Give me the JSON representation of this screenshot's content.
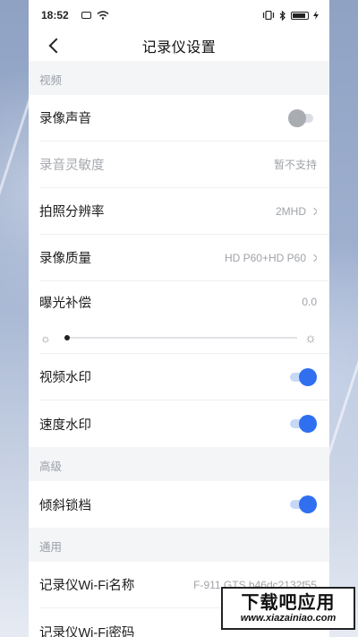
{
  "status_bar": {
    "time": "18:52"
  },
  "nav": {
    "title": "记录仪设置"
  },
  "sections": {
    "video": {
      "header": "视频",
      "record_sound": {
        "label": "录像声音",
        "enabled": false
      },
      "mic_sensitivity": {
        "label": "录音灵敏度",
        "value": "暂不支持"
      },
      "photo_resolution": {
        "label": "拍照分辨率",
        "value": "2MHD"
      },
      "record_quality": {
        "label": "录像质量",
        "value": "HD P60+HD P60"
      },
      "exposure": {
        "label": "曝光补偿",
        "value": "0.0",
        "slider_fraction": 0.0
      },
      "video_watermark": {
        "label": "视频水印",
        "enabled": true
      },
      "speed_watermark": {
        "label": "速度水印",
        "enabled": true
      }
    },
    "advanced": {
      "header": "高级",
      "tilt_lock": {
        "label": "倾斜锁档",
        "enabled": true
      }
    },
    "general": {
      "header": "通用",
      "wifi_name": {
        "label": "记录仪Wi-Fi名称",
        "value": "F-911 GTS b46dc2132f55"
      },
      "wifi_password": {
        "label": "记录仪Wi-Fi密码"
      }
    }
  },
  "watermark": {
    "title": "下载吧应用",
    "url": "www.xiazainiao.com"
  },
  "colors": {
    "accent": "#2f6ff0",
    "toggle_off": "#a9acb1",
    "background": "#f4f5f7"
  },
  "icons": {
    "sun_small": "☼",
    "sun_large": "☼"
  }
}
